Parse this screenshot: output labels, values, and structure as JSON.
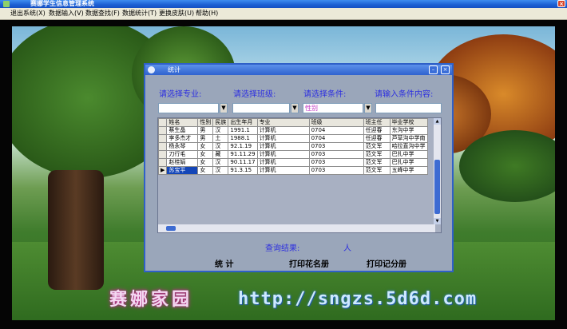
{
  "window": {
    "title": "赛娜学生信息管理系统",
    "close": "×"
  },
  "menu": [
    "退出系统(X)",
    "数据输入(V)",
    "数据查找(F)",
    "数据统计(T)",
    "更换皮肤(U)",
    "帮助(H)"
  ],
  "footer": {
    "cn": "赛娜家园",
    "url": "http://sngzs.5d6d.com"
  },
  "dialog": {
    "title": "统计",
    "buttons": {
      "minimize": "–",
      "close": "×"
    },
    "labels": {
      "major": "请选择专业:",
      "class": "请选择班级:",
      "condition": "请选择条件:",
      "input": "请输入条件内容:"
    },
    "fields": {
      "major": "",
      "class": "",
      "condition": "性别",
      "input": ""
    },
    "columns": [
      "姓名",
      "性别",
      "民族",
      "出生年月",
      "专业",
      "班级",
      "班主任",
      "毕业学校"
    ],
    "rows": [
      [
        "蔡生晶",
        "男",
        "汉",
        "1991.1",
        "计算机",
        "0704",
        "任迎春",
        "东沟中学"
      ],
      [
        "李多杰才",
        "男",
        "土",
        "1988.1",
        "计算机",
        "0704",
        "任迎春",
        "芦草沟中学南"
      ],
      [
        "杨永琴",
        "女",
        "汉",
        "92.1.19",
        "计算机",
        "0703",
        "范文军",
        "哈拉直沟中学"
      ],
      [
        "刀行毛",
        "女",
        "藏",
        "91.11.29",
        "计算机",
        "0703",
        "范文军",
        "巴扎中学"
      ],
      [
        "赵桂娟",
        "女",
        "汉",
        "90.11.17",
        "计算机",
        "0703",
        "范文军",
        "巴扎中学"
      ],
      [
        "苏宝平",
        "女",
        "汉",
        "91.3.15",
        "计算机",
        "0703",
        "范文军",
        "五峰中学"
      ]
    ],
    "selected_row": 5,
    "result_label": "查询结果:",
    "result_unit": "人",
    "actions": {
      "stats": "统   计",
      "print_names": "打印花名册",
      "print_scores": "打印记分册"
    }
  }
}
